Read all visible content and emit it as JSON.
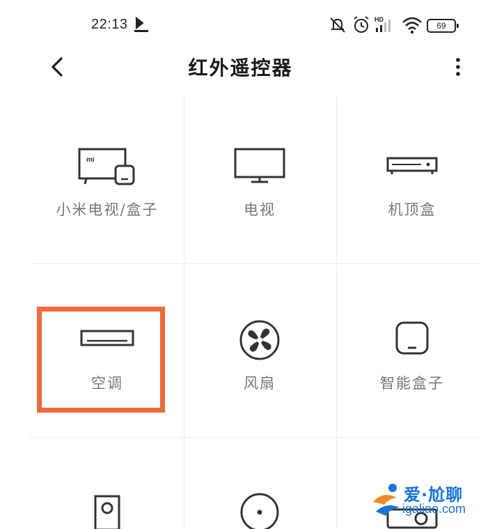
{
  "status": {
    "time": "22:13",
    "battery": "69",
    "signal_label": "HD"
  },
  "header": {
    "title": "红外遥控器"
  },
  "devices": [
    {
      "label": "小米电视/盒子",
      "icon": "mi-tv-box-icon"
    },
    {
      "label": "电视",
      "icon": "tv-icon"
    },
    {
      "label": "机顶盒",
      "icon": "set-top-box-icon"
    },
    {
      "label": "空调",
      "icon": "air-conditioner-icon"
    },
    {
      "label": "风扇",
      "icon": "fan-icon"
    },
    {
      "label": "智能盒子",
      "icon": "smart-box-icon"
    },
    {
      "label": "",
      "icon": "speaker-icon"
    },
    {
      "label": "",
      "icon": "dvd-icon"
    },
    {
      "label": "",
      "icon": "projector-icon"
    }
  ],
  "highlight_color": "#f0693a",
  "watermark": {
    "brand": "爱·尬聊",
    "url": "igaliao.com"
  }
}
